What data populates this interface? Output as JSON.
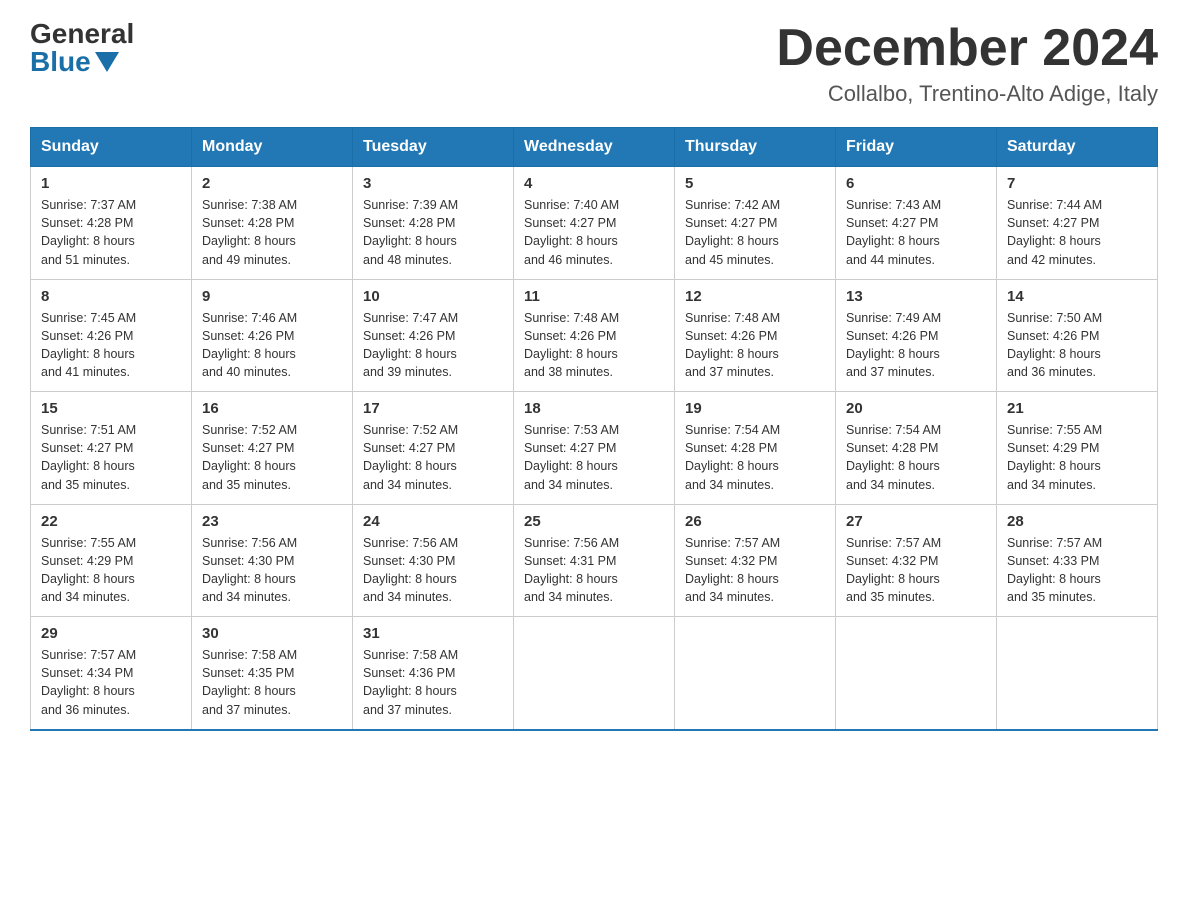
{
  "header": {
    "logo_general": "General",
    "logo_blue": "Blue",
    "title": "December 2024",
    "subtitle": "Collalbo, Trentino-Alto Adige, Italy"
  },
  "days": [
    "Sunday",
    "Monday",
    "Tuesday",
    "Wednesday",
    "Thursday",
    "Friday",
    "Saturday"
  ],
  "weeks": [
    [
      {
        "day": "1",
        "sunrise": "7:37 AM",
        "sunset": "4:28 PM",
        "daylight": "8 hours and 51 minutes."
      },
      {
        "day": "2",
        "sunrise": "7:38 AM",
        "sunset": "4:28 PM",
        "daylight": "8 hours and 49 minutes."
      },
      {
        "day": "3",
        "sunrise": "7:39 AM",
        "sunset": "4:28 PM",
        "daylight": "8 hours and 48 minutes."
      },
      {
        "day": "4",
        "sunrise": "7:40 AM",
        "sunset": "4:27 PM",
        "daylight": "8 hours and 46 minutes."
      },
      {
        "day": "5",
        "sunrise": "7:42 AM",
        "sunset": "4:27 PM",
        "daylight": "8 hours and 45 minutes."
      },
      {
        "day": "6",
        "sunrise": "7:43 AM",
        "sunset": "4:27 PM",
        "daylight": "8 hours and 44 minutes."
      },
      {
        "day": "7",
        "sunrise": "7:44 AM",
        "sunset": "4:27 PM",
        "daylight": "8 hours and 42 minutes."
      }
    ],
    [
      {
        "day": "8",
        "sunrise": "7:45 AM",
        "sunset": "4:26 PM",
        "daylight": "8 hours and 41 minutes."
      },
      {
        "day": "9",
        "sunrise": "7:46 AM",
        "sunset": "4:26 PM",
        "daylight": "8 hours and 40 minutes."
      },
      {
        "day": "10",
        "sunrise": "7:47 AM",
        "sunset": "4:26 PM",
        "daylight": "8 hours and 39 minutes."
      },
      {
        "day": "11",
        "sunrise": "7:48 AM",
        "sunset": "4:26 PM",
        "daylight": "8 hours and 38 minutes."
      },
      {
        "day": "12",
        "sunrise": "7:48 AM",
        "sunset": "4:26 PM",
        "daylight": "8 hours and 37 minutes."
      },
      {
        "day": "13",
        "sunrise": "7:49 AM",
        "sunset": "4:26 PM",
        "daylight": "8 hours and 37 minutes."
      },
      {
        "day": "14",
        "sunrise": "7:50 AM",
        "sunset": "4:26 PM",
        "daylight": "8 hours and 36 minutes."
      }
    ],
    [
      {
        "day": "15",
        "sunrise": "7:51 AM",
        "sunset": "4:27 PM",
        "daylight": "8 hours and 35 minutes."
      },
      {
        "day": "16",
        "sunrise": "7:52 AM",
        "sunset": "4:27 PM",
        "daylight": "8 hours and 35 minutes."
      },
      {
        "day": "17",
        "sunrise": "7:52 AM",
        "sunset": "4:27 PM",
        "daylight": "8 hours and 34 minutes."
      },
      {
        "day": "18",
        "sunrise": "7:53 AM",
        "sunset": "4:27 PM",
        "daylight": "8 hours and 34 minutes."
      },
      {
        "day": "19",
        "sunrise": "7:54 AM",
        "sunset": "4:28 PM",
        "daylight": "8 hours and 34 minutes."
      },
      {
        "day": "20",
        "sunrise": "7:54 AM",
        "sunset": "4:28 PM",
        "daylight": "8 hours and 34 minutes."
      },
      {
        "day": "21",
        "sunrise": "7:55 AM",
        "sunset": "4:29 PM",
        "daylight": "8 hours and 34 minutes."
      }
    ],
    [
      {
        "day": "22",
        "sunrise": "7:55 AM",
        "sunset": "4:29 PM",
        "daylight": "8 hours and 34 minutes."
      },
      {
        "day": "23",
        "sunrise": "7:56 AM",
        "sunset": "4:30 PM",
        "daylight": "8 hours and 34 minutes."
      },
      {
        "day": "24",
        "sunrise": "7:56 AM",
        "sunset": "4:30 PM",
        "daylight": "8 hours and 34 minutes."
      },
      {
        "day": "25",
        "sunrise": "7:56 AM",
        "sunset": "4:31 PM",
        "daylight": "8 hours and 34 minutes."
      },
      {
        "day": "26",
        "sunrise": "7:57 AM",
        "sunset": "4:32 PM",
        "daylight": "8 hours and 34 minutes."
      },
      {
        "day": "27",
        "sunrise": "7:57 AM",
        "sunset": "4:32 PM",
        "daylight": "8 hours and 35 minutes."
      },
      {
        "day": "28",
        "sunrise": "7:57 AM",
        "sunset": "4:33 PM",
        "daylight": "8 hours and 35 minutes."
      }
    ],
    [
      {
        "day": "29",
        "sunrise": "7:57 AM",
        "sunset": "4:34 PM",
        "daylight": "8 hours and 36 minutes."
      },
      {
        "day": "30",
        "sunrise": "7:58 AM",
        "sunset": "4:35 PM",
        "daylight": "8 hours and 37 minutes."
      },
      {
        "day": "31",
        "sunrise": "7:58 AM",
        "sunset": "4:36 PM",
        "daylight": "8 hours and 37 minutes."
      },
      null,
      null,
      null,
      null
    ]
  ]
}
